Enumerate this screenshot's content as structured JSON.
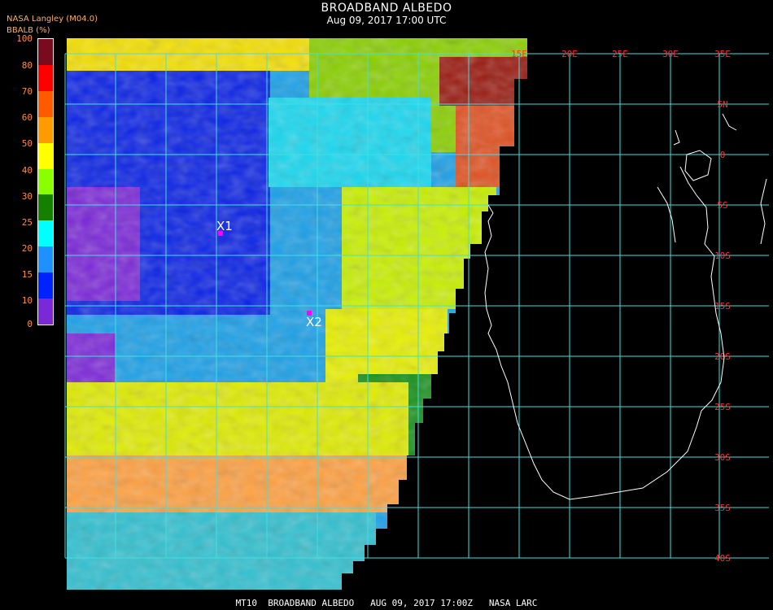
{
  "header": {
    "title": "BROADBAND ALBEDO",
    "subtitle": "Aug 09, 2017 17:00 UTC",
    "credit": "NASA Langley (M04.0)",
    "unit": "BBALB (%)"
  },
  "legend": {
    "ticks": [
      "100",
      "80",
      "70",
      "60",
      "50",
      "40",
      "30",
      "25",
      "20",
      "15",
      "10",
      "0"
    ],
    "colors": [
      "#7a0a1e",
      "#ff0000",
      "#ff5a00",
      "#ff9a00",
      "#ffff00",
      "#8aff00",
      "#138000",
      "#00ffff",
      "#1e90ff",
      "#0022ff",
      "#7b28d8"
    ]
  },
  "map": {
    "lon_labels": [
      "15E",
      "20E",
      "25E",
      "30E",
      "35E"
    ],
    "lat_labels": [
      "5N",
      "0",
      "5S",
      "10S",
      "15S",
      "20S",
      "25S",
      "30S",
      "35S",
      "40S"
    ],
    "grid_color": "#40e0e0"
  },
  "markers": [
    {
      "label": "X1",
      "color": "#ff00ff"
    },
    {
      "label": "X2",
      "color": "#ff00ff"
    }
  ],
  "footer": {
    "text": "MT10  BROADBAND ALBEDO   AUG 09, 2017 17:00Z   NASA LARC"
  }
}
